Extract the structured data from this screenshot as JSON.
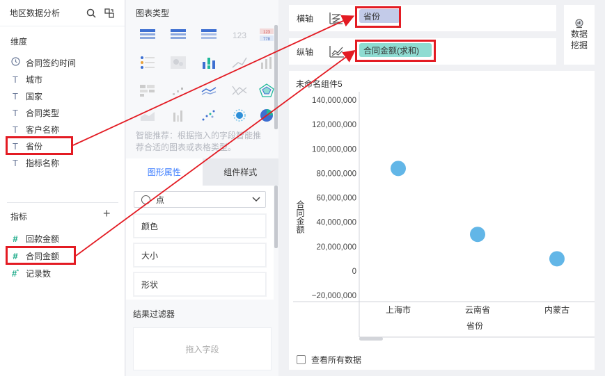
{
  "left": {
    "title": "地区数据分析",
    "dimension_label": "维度",
    "dimensions": [
      "合同签约时间",
      "城市",
      "国家",
      "合同类型",
      "客户名称",
      "省份",
      "指标名称"
    ],
    "measure_label": "指标",
    "measures": [
      "回款金额",
      "合同金额",
      "记录数"
    ]
  },
  "mid": {
    "chart_type_label": "图表类型",
    "smart_recommend": "智能推荐：根据拖入的字段智能推荐合适的图表或表格类型。",
    "tab_graph": "图形属性",
    "tab_style": "组件样式",
    "shape_select": "点",
    "props": [
      "颜色",
      "大小",
      "形状"
    ],
    "filter_title": "结果过滤器",
    "drop_hint": "拖入字段"
  },
  "right": {
    "x_axis_label": "横轴",
    "x_field": "省份",
    "y_axis_label": "纵轴",
    "y_field": "合同金额(求和)",
    "mining_line1": "数据",
    "mining_line2": "挖掘",
    "chart_title": "未命名组件5",
    "show_all": "查看所有数据"
  },
  "colors": {
    "accent": "#3b7cff",
    "highlight": "#e31b23",
    "point": "#62b6e7",
    "x_pill": "#c3cbe9",
    "y_pill": "#8fdcd2"
  },
  "chart_data": {
    "type": "scatter",
    "categories": [
      "上海市",
      "云南省",
      "内蒙古"
    ],
    "values": [
      84000000,
      30000000,
      10000000
    ],
    "xlabel": "省份",
    "ylabel": "合同金额",
    "ylim": [
      -20000000,
      140000000
    ],
    "yticks": [
      "140,000,000",
      "120,000,000",
      "100,000,000",
      "80,000,000",
      "60,000,000",
      "40,000,000",
      "20,000,000",
      "0",
      "−20,000,000"
    ]
  }
}
